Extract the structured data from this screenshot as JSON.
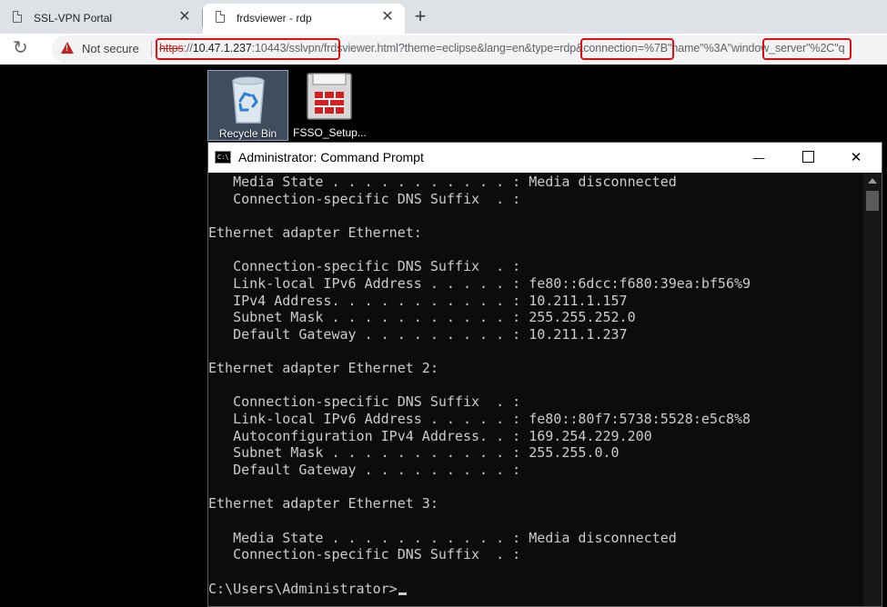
{
  "browser": {
    "tabs": [
      {
        "title": "SSL-VPN Portal",
        "active": false
      },
      {
        "title": "frdsviewer - rdp",
        "active": true
      }
    ],
    "close_glyph": "✕",
    "new_tab_glyph": "+",
    "reload_glyph": "↻",
    "security_label": "Not secure",
    "url": {
      "scheme": "https",
      "sep": "://",
      "host": "10.47.1.237",
      "rest": ":10443/sslvpn/frdsviewer.html?theme=eclipse&lang=en&type=rdp&connection=%7B\"name\"%3A\"window_server\"%2C\"q"
    },
    "warning_color": "#c5221f",
    "highlight_color": "#e01010"
  },
  "desktop": {
    "icons": [
      {
        "label": "Recycle Bin",
        "icon": "recycle-bin-icon",
        "selected": true
      },
      {
        "label": "FSSO_Setup...",
        "icon": "installer-icon",
        "selected": false
      }
    ]
  },
  "cmd_window": {
    "title": "Administrator: Command Prompt",
    "icon_text": "C:\\.",
    "minimize_glyph": "—",
    "close_glyph": "✕",
    "lines": [
      "   Media State . . . . . . . . . . . : Media disconnected",
      "   Connection-specific DNS Suffix  . :",
      "",
      "Ethernet adapter Ethernet:",
      "",
      "   Connection-specific DNS Suffix  . :",
      "   Link-local IPv6 Address . . . . . : fe80::6dcc:f680:39ea:bf56%9",
      "   IPv4 Address. . . . . . . . . . . : 10.211.1.157",
      "   Subnet Mask . . . . . . . . . . . : 255.255.252.0",
      "   Default Gateway . . . . . . . . . : 10.211.1.237",
      "",
      "Ethernet adapter Ethernet 2:",
      "",
      "   Connection-specific DNS Suffix  . :",
      "   Link-local IPv6 Address . . . . . : fe80::80f7:5738:5528:e5c8%8",
      "   Autoconfiguration IPv4 Address. . : 169.254.229.200",
      "   Subnet Mask . . . . . . . . . . . : 255.255.0.0",
      "   Default Gateway . . . . . . . . . :",
      "",
      "Ethernet adapter Ethernet 3:",
      "",
      "   Media State . . . . . . . . . . . : Media disconnected",
      "   Connection-specific DNS Suffix  . :",
      ""
    ],
    "prompt": "C:\\Users\\Administrator>",
    "background": "#0c0c0c",
    "text_color": "#cccccc"
  }
}
